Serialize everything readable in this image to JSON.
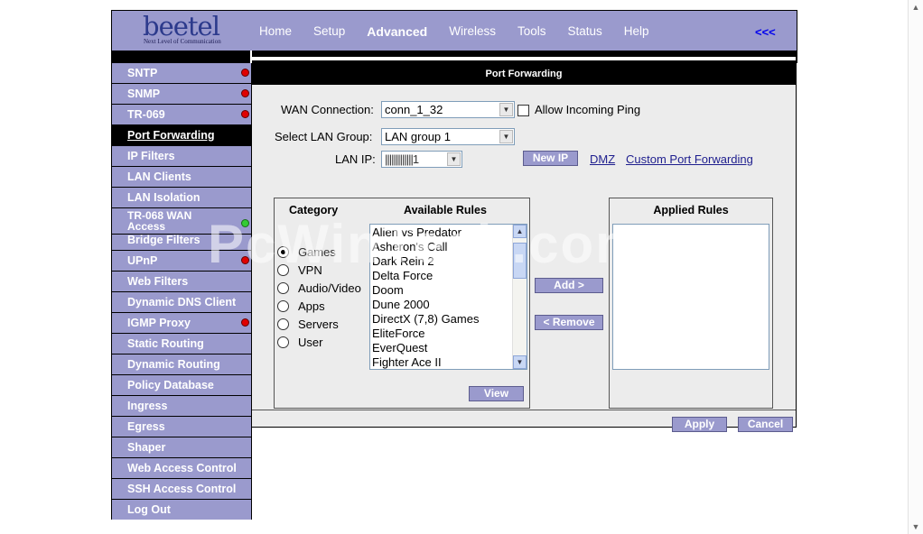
{
  "header": {
    "logo_text": "beetel",
    "logo_tagline": "Next Level of Communication",
    "nav": [
      "Home",
      "Setup",
      "Advanced",
      "Wireless",
      "Tools",
      "Status",
      "Help"
    ],
    "active_nav": "Advanced",
    "collapse_label": "<<<"
  },
  "sidebar": {
    "items": [
      {
        "label": "SNTP",
        "status": "red"
      },
      {
        "label": "SNMP",
        "status": "red"
      },
      {
        "label": "TR-069",
        "status": "red"
      },
      {
        "label": "Port Forwarding",
        "status": "",
        "active": true
      },
      {
        "label": "IP Filters",
        "status": ""
      },
      {
        "label": "LAN Clients",
        "status": ""
      },
      {
        "label": "LAN Isolation",
        "status": ""
      },
      {
        "label": "TR-068 WAN Access",
        "line1": "TR-068 WAN",
        "line2": "Access",
        "status": "green"
      },
      {
        "label": "Bridge Filters",
        "status": ""
      },
      {
        "label": "UPnP",
        "status": "red"
      },
      {
        "label": "Web Filters",
        "status": ""
      },
      {
        "label": "Dynamic DNS Client",
        "status": ""
      },
      {
        "label": "IGMP Proxy",
        "status": "red"
      },
      {
        "label": "Static Routing",
        "status": ""
      },
      {
        "label": "Dynamic Routing",
        "status": ""
      },
      {
        "label": "Policy Database",
        "status": ""
      },
      {
        "label": "Ingress",
        "status": ""
      },
      {
        "label": "Egress",
        "status": ""
      },
      {
        "label": "Shaper",
        "status": ""
      },
      {
        "label": "Web Access Control",
        "status": ""
      },
      {
        "label": "SSH Access Control",
        "status": ""
      },
      {
        "label": "Log Out",
        "status": ""
      }
    ]
  },
  "content": {
    "title": "Port Forwarding",
    "wan_connection_label": "WAN Connection:",
    "wan_connection_value": "conn_1_32",
    "allow_ping_label": "Allow Incoming Ping",
    "lan_group_label": "Select LAN Group:",
    "lan_group_value": "LAN group 1",
    "lan_ip_label": "LAN IP:",
    "lan_ip_value": "|||||||||||||1",
    "new_ip_label": "New IP",
    "dmz_label": "DMZ",
    "custom_pf_label": "Custom Port Forwarding",
    "category_header": "Category",
    "available_header": "Available Rules",
    "applied_header": "Applied Rules",
    "categories": [
      "Games",
      "VPN",
      "Audio/Video",
      "Apps",
      "Servers",
      "User"
    ],
    "selected_category": "Games",
    "available_rules": [
      "Alien vs Predator",
      "Asheron's Call",
      "Dark Rein 2",
      "Delta Force",
      "Doom",
      "Dune 2000",
      "DirectX (7,8) Games",
      "EliteForce",
      "EverQuest",
      "Fighter Ace II"
    ],
    "add_label": "Add >",
    "remove_label": "< Remove",
    "view_label": "View",
    "apply_label": "Apply",
    "cancel_label": "Cancel",
    "watermark": "PcWinTech.com"
  },
  "colors": {
    "accent": "#9a9acd",
    "status_red": "#e00000",
    "status_green": "#33cc33"
  }
}
